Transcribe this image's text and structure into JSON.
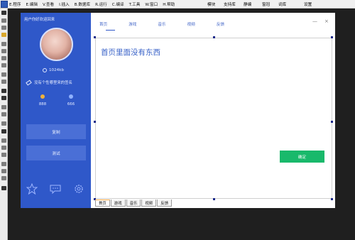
{
  "menubar": {
    "items": [
      "E.程序",
      "E.编辑",
      "V.查看",
      "I.插入",
      "B.数据库",
      "R.运行",
      "C.编译",
      "T.工具",
      "W.窗口",
      "H.帮助"
    ],
    "right_items": [
      "模块",
      "支持库",
      "静编",
      "窗冠",
      "词库",
      "设置"
    ]
  },
  "sidebar": {
    "title": "用户你好欢迎回来",
    "storage": "1024kb",
    "signature": "没有个性哪里来的签名",
    "stats": [
      "888",
      "666"
    ],
    "buttons": [
      "复制",
      "测试"
    ],
    "icons": [
      "star-icon",
      "chat-icon",
      "gear-icon"
    ],
    "accent_color": "#2f58c9"
  },
  "main": {
    "tabs": [
      "首页",
      "游戏",
      "音乐",
      "视频",
      "反馈"
    ],
    "window_controls": [
      "—",
      "×"
    ],
    "content_text": "首页里面没有东西",
    "confirm_label": "确定",
    "confirm_color": "#19b96b"
  },
  "bottom_tabs": [
    "首页",
    "游戏",
    "音乐",
    "视频",
    "反馈"
  ]
}
